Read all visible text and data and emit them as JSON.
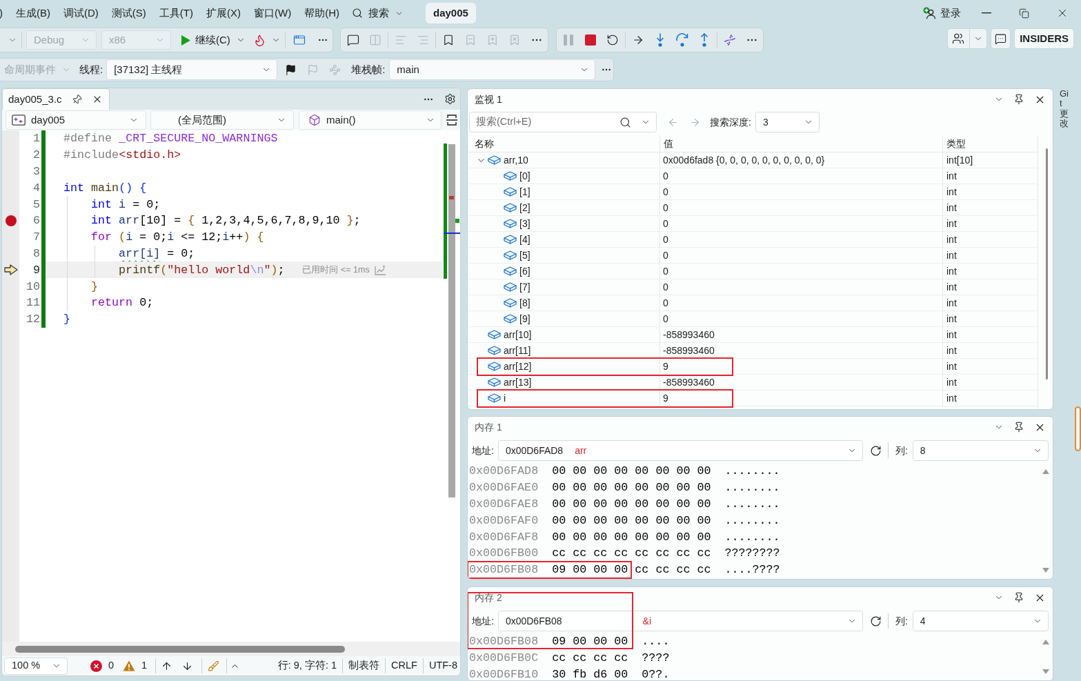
{
  "menu_bar": {
    "items": [
      ")",
      "生成(B)",
      "调试(D)",
      "测试(S)",
      "工具(T)",
      "扩展(X)",
      "窗口(W)",
      "帮助(H)"
    ],
    "search": "搜索",
    "solution": "day005",
    "sign_in": "登录"
  },
  "toolbar": {
    "configuration": {
      "label": "Debug",
      "disabled": true
    },
    "platform": {
      "label": "x86",
      "disabled": true
    },
    "continue": "继续(C)",
    "edit_tools": [
      {
        "kind": "comment",
        "disabled": false
      },
      {
        "kind": "columns",
        "disabled": true
      },
      {
        "kind": "separator"
      },
      {
        "kind": "align-left",
        "disabled": true
      },
      {
        "kind": "align-right",
        "disabled": true
      },
      {
        "kind": "separator"
      },
      {
        "kind": "bookmark",
        "disabled": false
      },
      {
        "kind": "bookmark-minus",
        "disabled": true
      },
      {
        "kind": "bookmark-plus",
        "disabled": true
      },
      {
        "kind": "bookmark-x",
        "disabled": true
      },
      {
        "kind": "more",
        "disabled": false
      }
    ],
    "debug_tools": [
      {
        "kind": "pause",
        "disabled": true
      },
      {
        "kind": "stop",
        "disabled": false
      },
      {
        "kind": "restart",
        "disabled": false
      },
      {
        "kind": "separator"
      },
      {
        "kind": "next-statement",
        "disabled": false
      },
      {
        "kind": "step-into",
        "disabled": false
      },
      {
        "kind": "step-over",
        "disabled": false
      },
      {
        "kind": "step-out",
        "disabled": false
      },
      {
        "kind": "separator"
      },
      {
        "kind": "dna",
        "disabled": false
      },
      {
        "kind": "more",
        "disabled": false
      }
    ],
    "badge": "INSIDERS"
  },
  "debug_location": {
    "lifecycle_events": {
      "label": "命周期事件",
      "disabled": true
    },
    "thread_label": "线程:",
    "thread": "[37132] 主线程",
    "flags": [
      {
        "kind": "flag",
        "disabled": false
      },
      {
        "kind": "flag",
        "disabled": true
      },
      {
        "kind": "threads",
        "disabled": true
      }
    ],
    "stack_frame_label": "堆栈帧:",
    "stack_frame": "main"
  },
  "editor": {
    "tabs": [
      {
        "label": "day005_3.c",
        "selected": true
      }
    ],
    "project": "day005",
    "scope": "(全局范围)",
    "member": "main()",
    "lines": [
      {
        "number": "1",
        "breakpoint": false,
        "current": false,
        "tokens": [
          {
            "text": "#define",
            "kind": "preproc"
          },
          {
            "text": " _CRT_SECURE_NO_WARNINGS",
            "kind": "macro"
          }
        ]
      },
      {
        "number": "2",
        "breakpoint": false,
        "current": false,
        "tokens": [
          {
            "text": "#include",
            "kind": "preproc"
          },
          {
            "text": "<stdio.h>",
            "kind": "string"
          }
        ]
      },
      {
        "number": "3",
        "breakpoint": false,
        "current": false
      },
      {
        "number": "4",
        "breakpoint": false,
        "current": false,
        "tokens": [
          {
            "text": "int",
            "kind": "keyword"
          },
          {
            "text": " main",
            "kind": "function"
          },
          {
            "text": "()",
            "kind": "brace1"
          },
          {
            "text": " {",
            "kind": "brace1"
          }
        ]
      },
      {
        "number": "5",
        "breakpoint": false,
        "current": false,
        "tokens": [
          {
            "text": "    int",
            "kind": "keyword"
          },
          {
            "text": " i",
            "kind": "variable"
          },
          {
            "text": " = 0;",
            "kind": "plain"
          }
        ]
      },
      {
        "number": "6",
        "breakpoint": true,
        "current": false,
        "tokens": [
          {
            "text": "    int",
            "kind": "keyword"
          },
          {
            "text": " arr",
            "kind": "variable"
          },
          {
            "text": "[10] = ",
            "kind": "plain"
          },
          {
            "text": "{",
            "kind": "brace2"
          },
          {
            "text": " 1,2,3,4,5,6,7,8,9,10 ",
            "kind": "plain"
          },
          {
            "text": "}",
            "kind": "brace2"
          },
          {
            "text": ";",
            "kind": "plain"
          }
        ]
      },
      {
        "number": "7",
        "breakpoint": false,
        "current": false,
        "tokens": [
          {
            "text": "    for",
            "kind": "control"
          },
          {
            "text": " (",
            "kind": "brace2"
          },
          {
            "text": "i",
            "kind": "variable"
          },
          {
            "text": " = 0;",
            "kind": "plain"
          },
          {
            "text": "i",
            "kind": "variable"
          },
          {
            "text": " <= 12;",
            "kind": "plain"
          },
          {
            "text": "i",
            "kind": "variable"
          },
          {
            "text": "++",
            "kind": "plain"
          },
          {
            "text": ")",
            "kind": "brace2"
          },
          {
            "text": " {",
            "kind": "brace2"
          }
        ]
      },
      {
        "number": "8",
        "breakpoint": false,
        "current": false,
        "tokens": [
          {
            "text": "        arr[i]",
            "kind": "warning"
          },
          {
            "text": " = 0;",
            "kind": "plain"
          }
        ]
      },
      {
        "number": "9",
        "breakpoint": false,
        "current": true,
        "tokens": [
          {
            "text": "        printf",
            "kind": "function"
          },
          {
            "text": "(",
            "kind": "brace2"
          },
          {
            "text": "\"hello world",
            "kind": "string"
          },
          {
            "text": "\\n",
            "kind": "escape"
          },
          {
            "text": "\"",
            "kind": "string"
          },
          {
            "text": ")",
            "kind": "brace2"
          },
          {
            "text": ";",
            "kind": "plain"
          }
        ],
        "hint": "已用时间 <= 1ms"
      },
      {
        "number": "10",
        "breakpoint": false,
        "current": false,
        "tokens": [
          {
            "text": "    }",
            "kind": "brace2"
          }
        ]
      },
      {
        "number": "11",
        "breakpoint": false,
        "current": false,
        "tokens": [
          {
            "text": "    return",
            "kind": "control"
          },
          {
            "text": " 0;",
            "kind": "plain"
          }
        ]
      },
      {
        "number": "12",
        "breakpoint": false,
        "current": false,
        "tokens": [
          {
            "text": "}",
            "kind": "brace1"
          }
        ]
      }
    ],
    "status_bar": {
      "zoom": "100 %",
      "errors": "0",
      "warnings": "1",
      "position": "行: 9, 字符: 1",
      "indentation": "制表符",
      "line_ending": "CRLF",
      "encoding": "UTF-8"
    }
  },
  "watch": {
    "title": "监视 1",
    "search_placeholder": "搜索(Ctrl+E)",
    "nav": [
      {
        "kind": "back",
        "disabled": true
      },
      {
        "kind": "forward",
        "disabled": true
      }
    ],
    "depth_label": "搜索深度:",
    "depth": "3",
    "columns": [
      "名称",
      "值",
      "类型"
    ],
    "rows": [
      {
        "name": "arr,10",
        "value": "0x00d6fad8 {0, 0, 0, 0, 0, 0, 0, 0, 0, 0}",
        "type": "int[10]",
        "expanded": true,
        "annotated": false,
        "children": [
          {
            "name": "[0]",
            "value": "0",
            "type": "int",
            "annotated": false
          },
          {
            "name": "[1]",
            "value": "0",
            "type": "int",
            "annotated": false
          },
          {
            "name": "[2]",
            "value": "0",
            "type": "int",
            "annotated": false
          },
          {
            "name": "[3]",
            "value": "0",
            "type": "int",
            "annotated": false
          },
          {
            "name": "[4]",
            "value": "0",
            "type": "int",
            "annotated": false
          },
          {
            "name": "[5]",
            "value": "0",
            "type": "int",
            "annotated": false
          },
          {
            "name": "[6]",
            "value": "0",
            "type": "int",
            "annotated": false
          },
          {
            "name": "[7]",
            "value": "0",
            "type": "int",
            "annotated": false
          },
          {
            "name": "[8]",
            "value": "0",
            "type": "int",
            "annotated": false
          },
          {
            "name": "[9]",
            "value": "0",
            "type": "int",
            "annotated": false
          }
        ]
      },
      {
        "name": "arr[10]",
        "value": "-858993460",
        "type": "int",
        "annotated": false
      },
      {
        "name": "arr[11]",
        "value": "-858993460",
        "type": "int",
        "annotated": false
      },
      {
        "name": "arr[12]",
        "value": "9",
        "type": "int",
        "annotated": true
      },
      {
        "name": "arr[13]",
        "value": "-858993460",
        "type": "int",
        "annotated": false
      },
      {
        "name": "i",
        "value": "9",
        "type": "int",
        "annotated": true
      }
    ]
  },
  "memory": [
    {
      "title": "内存 1",
      "address_label": "地址:",
      "address": "0x00D6FAD8",
      "note": "arr",
      "columns_label": "列:",
      "columns": "8",
      "annotated": false,
      "rows": [
        {
          "address": "0x00D6FAD8",
          "bytes": "00 00 00 00 00 00 00 00",
          "ascii": "........",
          "annotated": false
        },
        {
          "address": "0x00D6FAE0",
          "bytes": "00 00 00 00 00 00 00 00",
          "ascii": "........",
          "annotated": false
        },
        {
          "address": "0x00D6FAE8",
          "bytes": "00 00 00 00 00 00 00 00",
          "ascii": "........",
          "annotated": false
        },
        {
          "address": "0x00D6FAF0",
          "bytes": "00 00 00 00 00 00 00 00",
          "ascii": "........",
          "annotated": false
        },
        {
          "address": "0x00D6FAF8",
          "bytes": "00 00 00 00 00 00 00 00",
          "ascii": "........",
          "annotated": false
        },
        {
          "address": "0x00D6FB00",
          "bytes": "cc cc cc cc cc cc cc cc",
          "ascii": "????????",
          "annotated": false
        },
        {
          "address": "0x00D6FB08",
          "bytes": "09 00 00 00 cc cc cc cc",
          "ascii": "....????",
          "annotated": true
        }
      ]
    },
    {
      "title": "内存 2",
      "address_label": "地址:",
      "address": "0x00D6FB08",
      "note": "&i",
      "columns_label": "列:",
      "columns": "4",
      "annotated": true,
      "rows": [
        {
          "address": "0x00D6FB08",
          "bytes": "09 00 00 00",
          "ascii": "....",
          "annotated": false
        },
        {
          "address": "0x00D6FB0C",
          "bytes": "cc cc cc cc",
          "ascii": "????",
          "annotated": false
        },
        {
          "address": "0x00D6FB10",
          "bytes": "30 fb d6 00",
          "ascii": "0??.",
          "annotated": false
        }
      ]
    }
  ],
  "side_tab": "Git 更改"
}
